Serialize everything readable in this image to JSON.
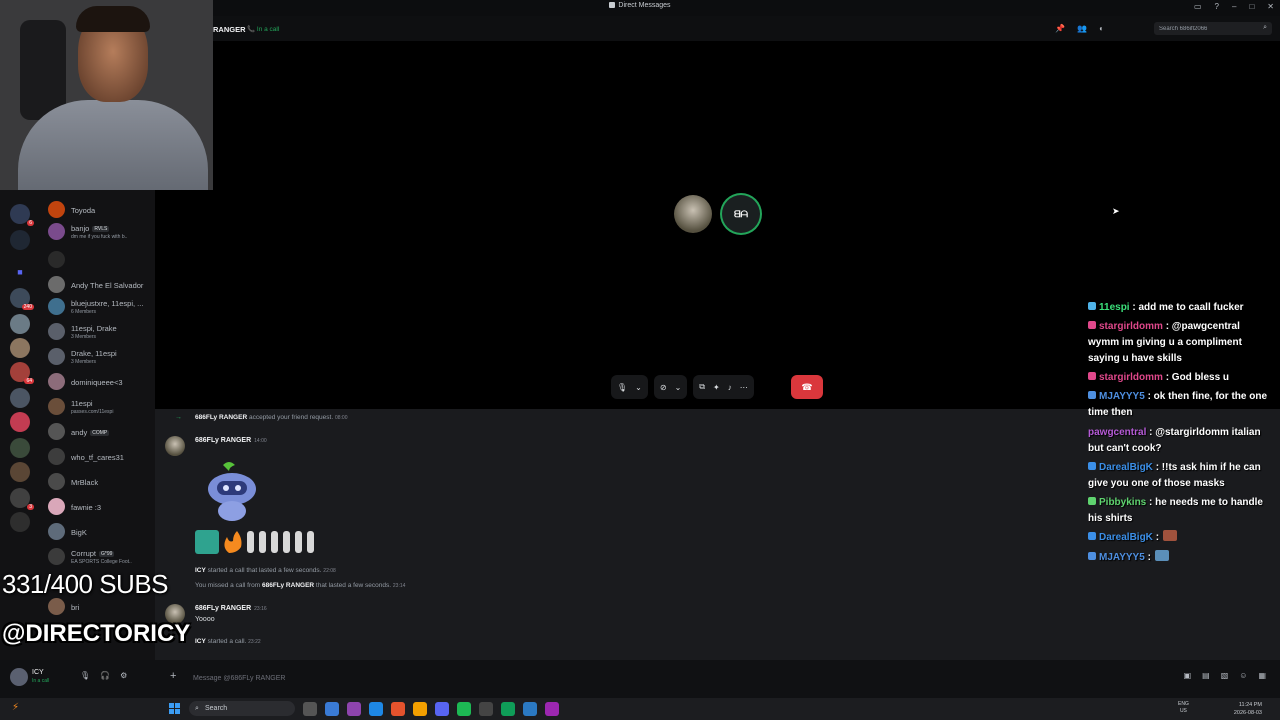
{
  "window": {
    "title": "Direct Messages"
  },
  "header": {
    "name": "RANGER",
    "status": "In a call",
    "search_placeholder": "Search 686ifl2066"
  },
  "dm_list": [
    {
      "name": "Toyoda",
      "sub": "",
      "color": "#c1440e"
    },
    {
      "name": "banjo",
      "tag": "RVLS",
      "sub": "dm me if you fuck with b..",
      "color": "#7a4b8c"
    },
    {
      "name": "",
      "sub": "",
      "color": "#2a2a2a"
    },
    {
      "name": "Andy The El Salvador",
      "sub": "",
      "color": "#6b6b6b"
    },
    {
      "name": "bluejustxre, 11espi, ...",
      "sub": "6 Members",
      "color": "#3f6f8e"
    },
    {
      "name": "11espi, Drake",
      "sub": "3 Members",
      "color": "#5a5f6a"
    },
    {
      "name": "Drake, 11espi",
      "sub": "3 Members",
      "color": "#5a5f6a"
    },
    {
      "name": "dominiqueee<3",
      "sub": "",
      "color": "#8c6c7a"
    },
    {
      "name": "11espi",
      "sub": "passes.com/11espi",
      "color": "#6a4e3a"
    },
    {
      "name": "andy",
      "tag": "COMP",
      "sub": "",
      "color": "#555"
    },
    {
      "name": "who_tf_cares31",
      "sub": "",
      "color": "#3d3d3d"
    },
    {
      "name": "MrBlack",
      "sub": "",
      "color": "#4a4a4a"
    },
    {
      "name": "fawnie :3",
      "sub": "",
      "color": "#d9a7b9"
    },
    {
      "name": "BigK",
      "sub": "",
      "color": "#5e6b7a"
    },
    {
      "name": "Corrupt",
      "tag": "G*99",
      "sub": "EA SPORTS College Foot..",
      "color": "#3b3b3b"
    },
    {
      "name": "bri",
      "sub": "",
      "color": "#7a5c4a"
    }
  ],
  "user_panel": {
    "name": "ICY",
    "status": "In a call"
  },
  "messages": {
    "sys1": {
      "name": "686FLy RANGER",
      "text": "accepted your friend request.",
      "time": "08:00"
    },
    "msg1": {
      "author": "686FLy RANGER",
      "time": "14:00"
    },
    "sys2": {
      "name": "ICY",
      "text": "started a call that lasted a few seconds.",
      "time": "22:08"
    },
    "sys3": {
      "pre": "You missed a call from",
      "name": "686FLy RANGER",
      "text": "that lasted a few seconds.",
      "time": "23:14"
    },
    "msg2": {
      "author": "686FLy RANGER",
      "time": "23:16",
      "body": "Yoooo"
    },
    "sys4": {
      "name": "ICY",
      "text": "started a call.",
      "time": "23:22"
    }
  },
  "composer": {
    "placeholder": "Message @686FLy RANGER"
  },
  "taskbar": {
    "search": "Search",
    "lang": "ENG",
    "region": "US",
    "time": "11:24 PM",
    "date": "2026-08-03"
  },
  "overlay": {
    "subs": "331/400 SUBS",
    "handle": "@DIRECTORICY",
    "chat": [
      {
        "user": "11espi",
        "color": "#3be07a",
        "text": ": add me to caall fucker"
      },
      {
        "user": "stargirldomm",
        "color": "#e0488b",
        "text": ": @pawgcentral wymm im giving u a compliment saying u have skills",
        "mention": true
      },
      {
        "user": "stargirldomm",
        "color": "#e0488b",
        "text": ": God bless u"
      },
      {
        "user": "MJAYYY5",
        "color": "#4e8fe0",
        "text": ": ok then fine, for the one time then"
      },
      {
        "user": "pawgcentral",
        "color": "#b55ad6",
        "text": ": @stargirldomm italian but can't cook?",
        "mention": true
      },
      {
        "user": "DarealBigK",
        "color": "#3b8fe8",
        "text": ": !!ts ask him if he can give you one of those masks"
      },
      {
        "user": "Pibbykins",
        "color": "#5fd36f",
        "text": ": he needs me to handle his shirts"
      },
      {
        "user": "DarealBigK",
        "color": "#3b8fe8",
        "text": ":"
      },
      {
        "user": "MJAYYY5",
        "color": "#4e8fe0",
        "text": ":"
      }
    ]
  }
}
